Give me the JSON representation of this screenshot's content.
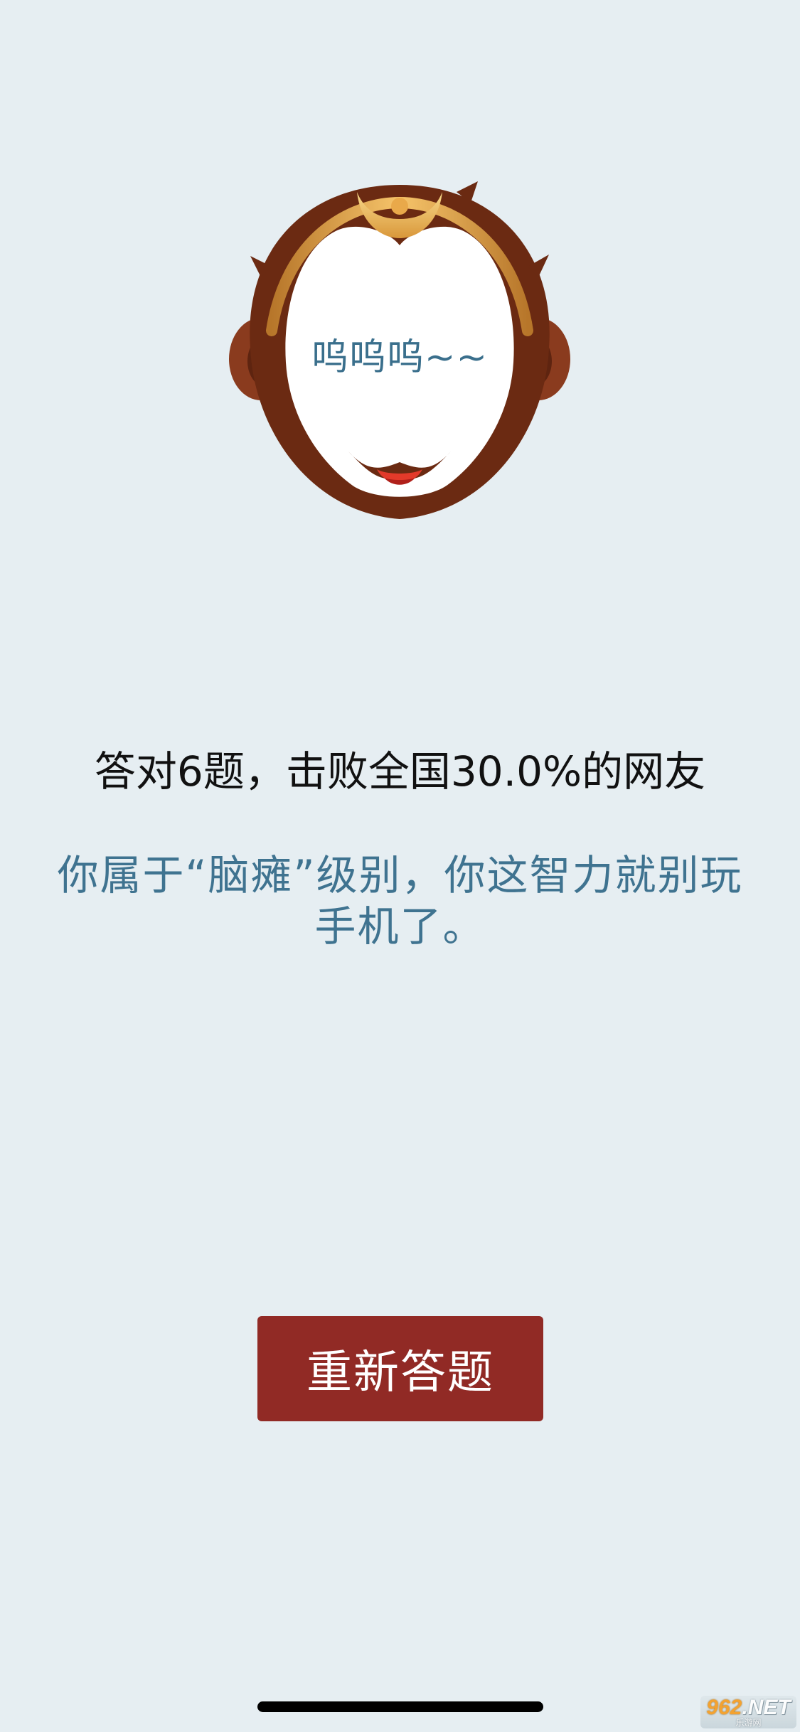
{
  "avatar": {
    "face_text": "呜呜呜~~"
  },
  "result": {
    "score_line": "答对6题，击败全国30.0%的网友",
    "verdict": "你属于“脑瘫”级别，你这智力就别玩手机了。"
  },
  "actions": {
    "retry_label": "重新答题"
  },
  "watermark": {
    "brand_accent": "962",
    "brand_rest": ".NET",
    "subtitle": "乐游网"
  },
  "colors": {
    "background": "#e6eef2",
    "button": "#912a25",
    "verdict_text": "#3f7390"
  }
}
